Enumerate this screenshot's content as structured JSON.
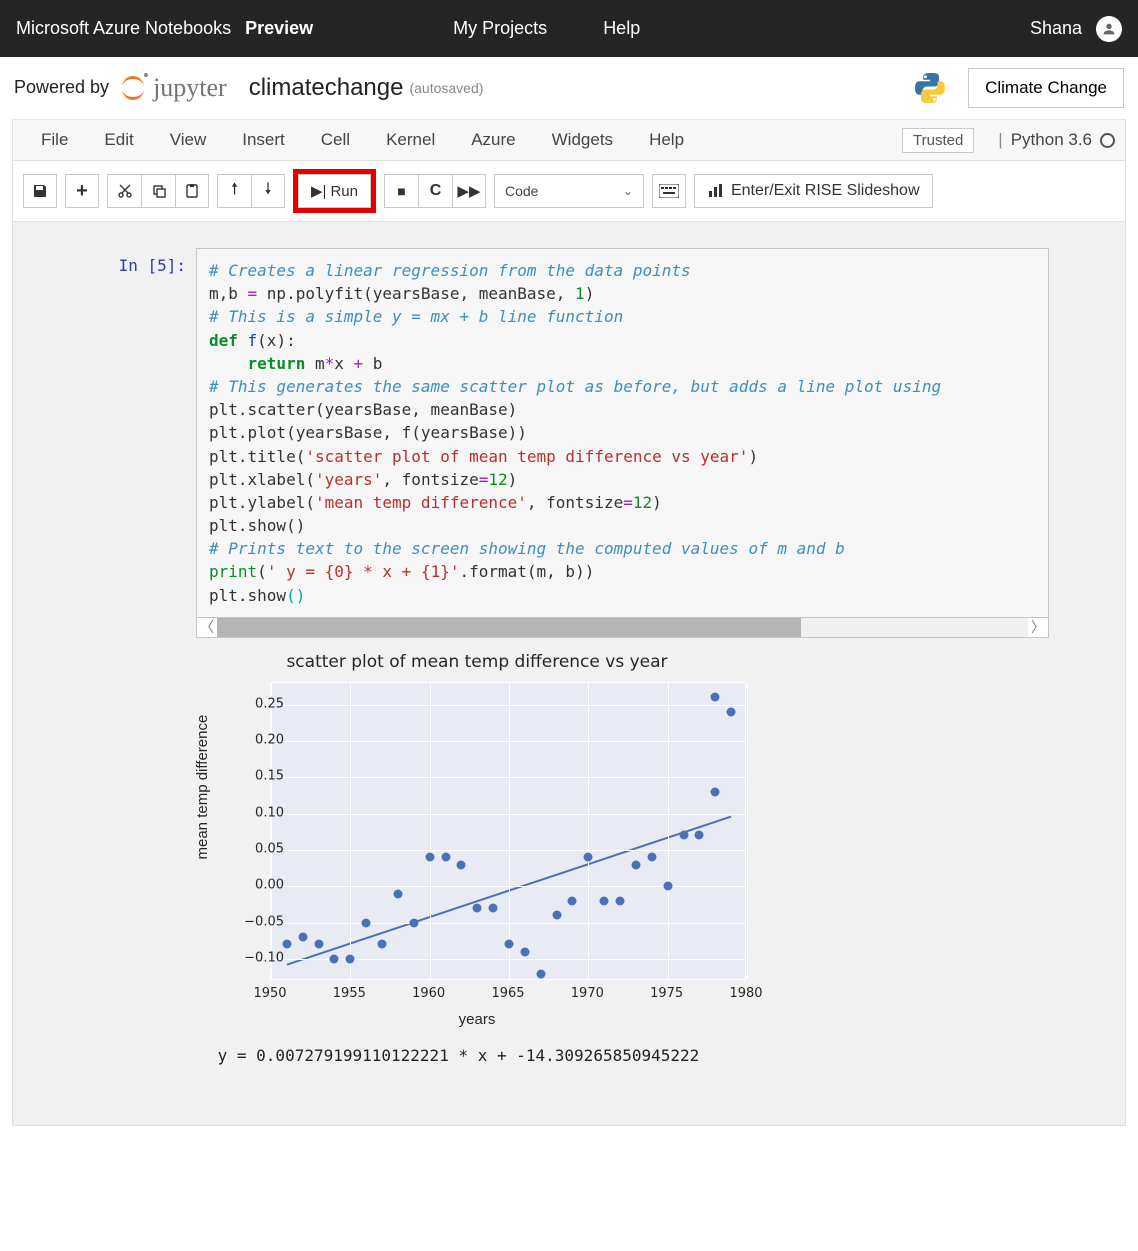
{
  "azure": {
    "brand": "Microsoft Azure Notebooks",
    "preview": "Preview",
    "nav": {
      "projects": "My Projects",
      "help": "Help"
    },
    "username": "Shana"
  },
  "notebook": {
    "powered_by": "Powered by",
    "jupyter_label": "jupyter",
    "name": "climatechange",
    "autosaved": "(autosaved)",
    "kernel_button": "Climate Change"
  },
  "menu": {
    "file": "File",
    "edit": "Edit",
    "view": "View",
    "insert": "Insert",
    "cell": "Cell",
    "kernel": "Kernel",
    "azure": "Azure",
    "widgets": "Widgets",
    "help": "Help",
    "trusted": "Trusted",
    "kernel_name": "Python 3.6"
  },
  "toolbar": {
    "run": "Run",
    "cell_type": "Code",
    "rise": "Enter/Exit RISE Slideshow"
  },
  "cell": {
    "prompt": "In [5]:",
    "code": {
      "l1": "# Creates a linear regression from the data points",
      "l2a": "m,b ",
      "l2b": "= ",
      "l2c": "np.polyfit(yearsBase, meanBase, ",
      "l2d": "1",
      "l2e": ")",
      "l3": "",
      "l4": "# This is a simple y = mx + b line function",
      "l5a": "def ",
      "l5b": "f",
      "l5c": "(x):",
      "l6a": "    ",
      "l6b": "return ",
      "l6c": "m",
      "l6d": "*",
      "l6e": "x ",
      "l6f": "+ ",
      "l6g": "b",
      "l7": "",
      "l8": "# This generates the same scatter plot as before, but adds a line plot using",
      "l9": "plt.scatter(yearsBase, meanBase)",
      "l10": "plt.plot(yearsBase, f(yearsBase))",
      "l11a": "plt.title(",
      "l11b": "'scatter plot of mean temp difference vs year'",
      "l11c": ")",
      "l12a": "plt.xlabel(",
      "l12b": "'years'",
      "l12c": ", fontsize",
      "l12d": "=",
      "l12e": "12",
      "l12f": ")",
      "l13a": "plt.ylabel(",
      "l13b": "'mean temp difference'",
      "l13c": ", fontsize",
      "l13d": "=",
      "l13e": "12",
      "l13f": ")",
      "l14": "plt.show()",
      "l15": "",
      "l16": "# Prints text to the screen showing the computed values of m and b",
      "l17a": "print",
      "l17b": "(",
      "l17c": "' y = {0} * x + {1}'",
      "l17d": ".format(m, b))",
      "l18a": "plt.show",
      "l18b": "(",
      "l18c": ")"
    }
  },
  "output_text": " y = 0.007279199110122221 * x + -14.309265850945222",
  "chart_data": {
    "type": "scatter_with_fit",
    "title": "scatter plot of mean temp difference vs year",
    "xlabel": "years",
    "ylabel": "mean temp difference",
    "xlim": [
      1950,
      1980
    ],
    "ylim": [
      -0.13,
      0.28
    ],
    "xticks": [
      1950,
      1955,
      1960,
      1965,
      1970,
      1975,
      1980
    ],
    "yticks": [
      -0.1,
      -0.05,
      0.0,
      0.05,
      0.1,
      0.15,
      0.2,
      0.25
    ],
    "ytick_labels": [
      "−0.10",
      "−0.05",
      "0.00",
      "0.05",
      "0.10",
      "0.15",
      "0.20",
      "0.25"
    ],
    "points": [
      {
        "x": 1951,
        "y": -0.08
      },
      {
        "x": 1952,
        "y": -0.07
      },
      {
        "x": 1953,
        "y": -0.08
      },
      {
        "x": 1954,
        "y": -0.1
      },
      {
        "x": 1955,
        "y": -0.1
      },
      {
        "x": 1956,
        "y": -0.05
      },
      {
        "x": 1957,
        "y": -0.08
      },
      {
        "x": 1958,
        "y": -0.01
      },
      {
        "x": 1959,
        "y": -0.05
      },
      {
        "x": 1960,
        "y": 0.04
      },
      {
        "x": 1961,
        "y": 0.04
      },
      {
        "x": 1962,
        "y": 0.03
      },
      {
        "x": 1963,
        "y": -0.03
      },
      {
        "x": 1964,
        "y": -0.03
      },
      {
        "x": 1965,
        "y": -0.08
      },
      {
        "x": 1966,
        "y": -0.09
      },
      {
        "x": 1967,
        "y": -0.12
      },
      {
        "x": 1968,
        "y": -0.04
      },
      {
        "x": 1969,
        "y": -0.02
      },
      {
        "x": 1970,
        "y": 0.04
      },
      {
        "x": 1971,
        "y": -0.02
      },
      {
        "x": 1972,
        "y": -0.02
      },
      {
        "x": 1973,
        "y": 0.03
      },
      {
        "x": 1974,
        "y": 0.04
      },
      {
        "x": 1975,
        "y": 0.0
      },
      {
        "x": 1976,
        "y": 0.07
      },
      {
        "x": 1977,
        "y": 0.07
      },
      {
        "x": 1978,
        "y": 0.13
      },
      {
        "x": 1978,
        "y": 0.26
      },
      {
        "x": 1979,
        "y": 0.24
      }
    ],
    "fit": {
      "m": 0.007279199110122221,
      "b": -14.309265850945222
    }
  }
}
